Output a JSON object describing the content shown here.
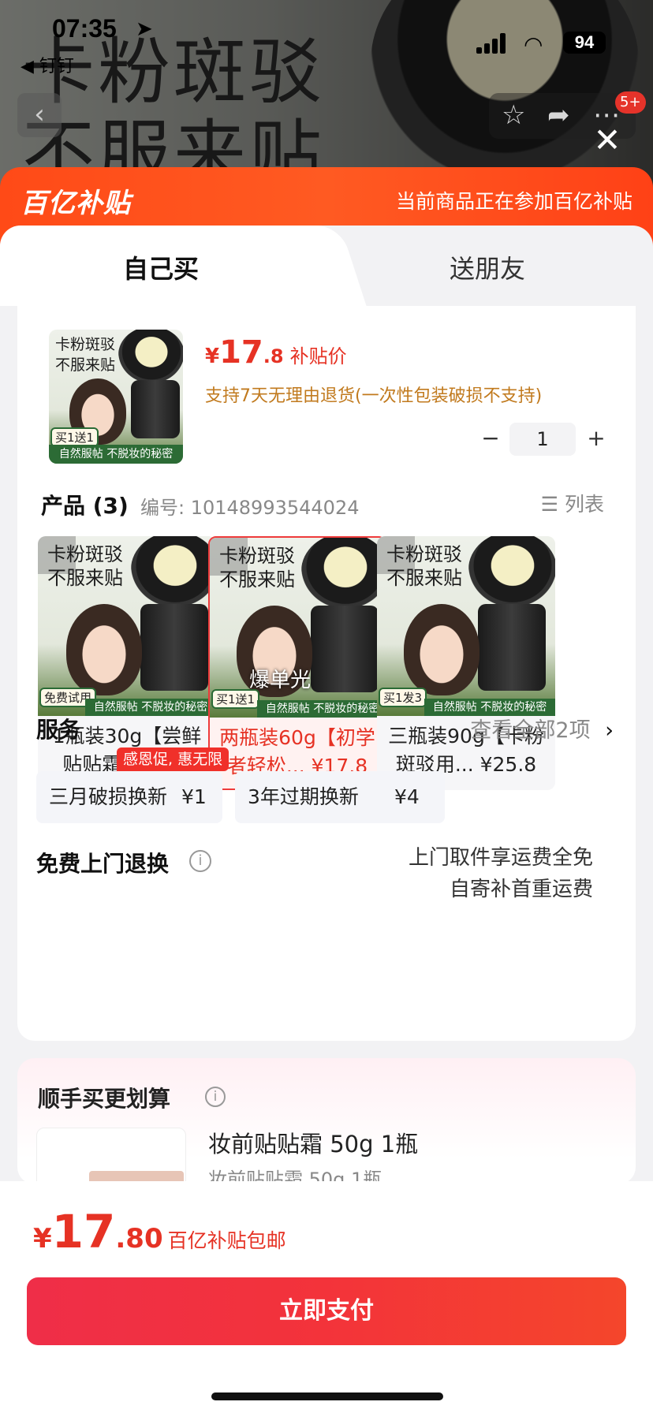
{
  "status_bar": {
    "time": "07:35",
    "back_app": "◀ 钉钉",
    "battery": "94"
  },
  "background": {
    "title_text": "卡粉斑驳\n不服来贴",
    "notification_count": "5+"
  },
  "header": {
    "brand": "百亿补贴",
    "notice": "当前商品正在参加百亿补贴"
  },
  "tabs": [
    {
      "label": "自己买",
      "selected": true
    },
    {
      "label": "送朋友",
      "selected": false
    }
  ],
  "product": {
    "image_text": {
      "title": "卡粉斑驳\n不服来贴",
      "badge": "买1送1",
      "strip": "自然服帖 不脱妆的秘密"
    },
    "price_symbol": "¥",
    "price_int": "17",
    "price_dec": ".8",
    "price_tag": "补贴价",
    "return_note": "支持7天无理由退货(一次性包装破损不支持)",
    "quantity": "1"
  },
  "products_section": {
    "title": "产品 (3)",
    "code_label": "编号: 10148993544024",
    "list_label": "列表",
    "variants": [
      {
        "name": "1瓶装30g【尝鲜贴贴霜】 ¥9.8",
        "badge": "免费试用",
        "selected": false
      },
      {
        "name": "两瓶装60g【初学者轻松... ¥17.8",
        "badge": "买1送1",
        "hot": "爆单光",
        "selected": true
      },
      {
        "name": "三瓶装90g【卡粉斑驳用... ¥25.8",
        "badge": "买1发3",
        "selected": false
      }
    ],
    "image_title": "卡粉斑驳\n不服来贴",
    "image_strip": "自然服帖 不脱妆的秘密"
  },
  "service": {
    "title": "服务",
    "more": "查看全部2项",
    "chips": [
      {
        "label": "三月破损换新",
        "price": "¥1"
      },
      {
        "label": "3年过期换新",
        "price": "¥4"
      }
    ],
    "promo_badge": "感恩促, 惠无限"
  },
  "free_return": {
    "title": "免费上门退换",
    "line1": "上门取件享运费全免",
    "line2": "自寄补首重运费"
  },
  "addon": {
    "title": "顺手买更划算",
    "item_name": "妆前贴贴霜 50g 1瓶",
    "item_sub": "妆前贴贴霜 50g 1瓶"
  },
  "bottom": {
    "price_symbol": "¥",
    "price_int": "17",
    "price_dec": ".80",
    "note": "百亿补贴包邮",
    "pay_label": "立即支付"
  },
  "colors": {
    "accent": "#e63224",
    "brand_orange": "#ff4a17",
    "pay_button": "#f3333a"
  }
}
